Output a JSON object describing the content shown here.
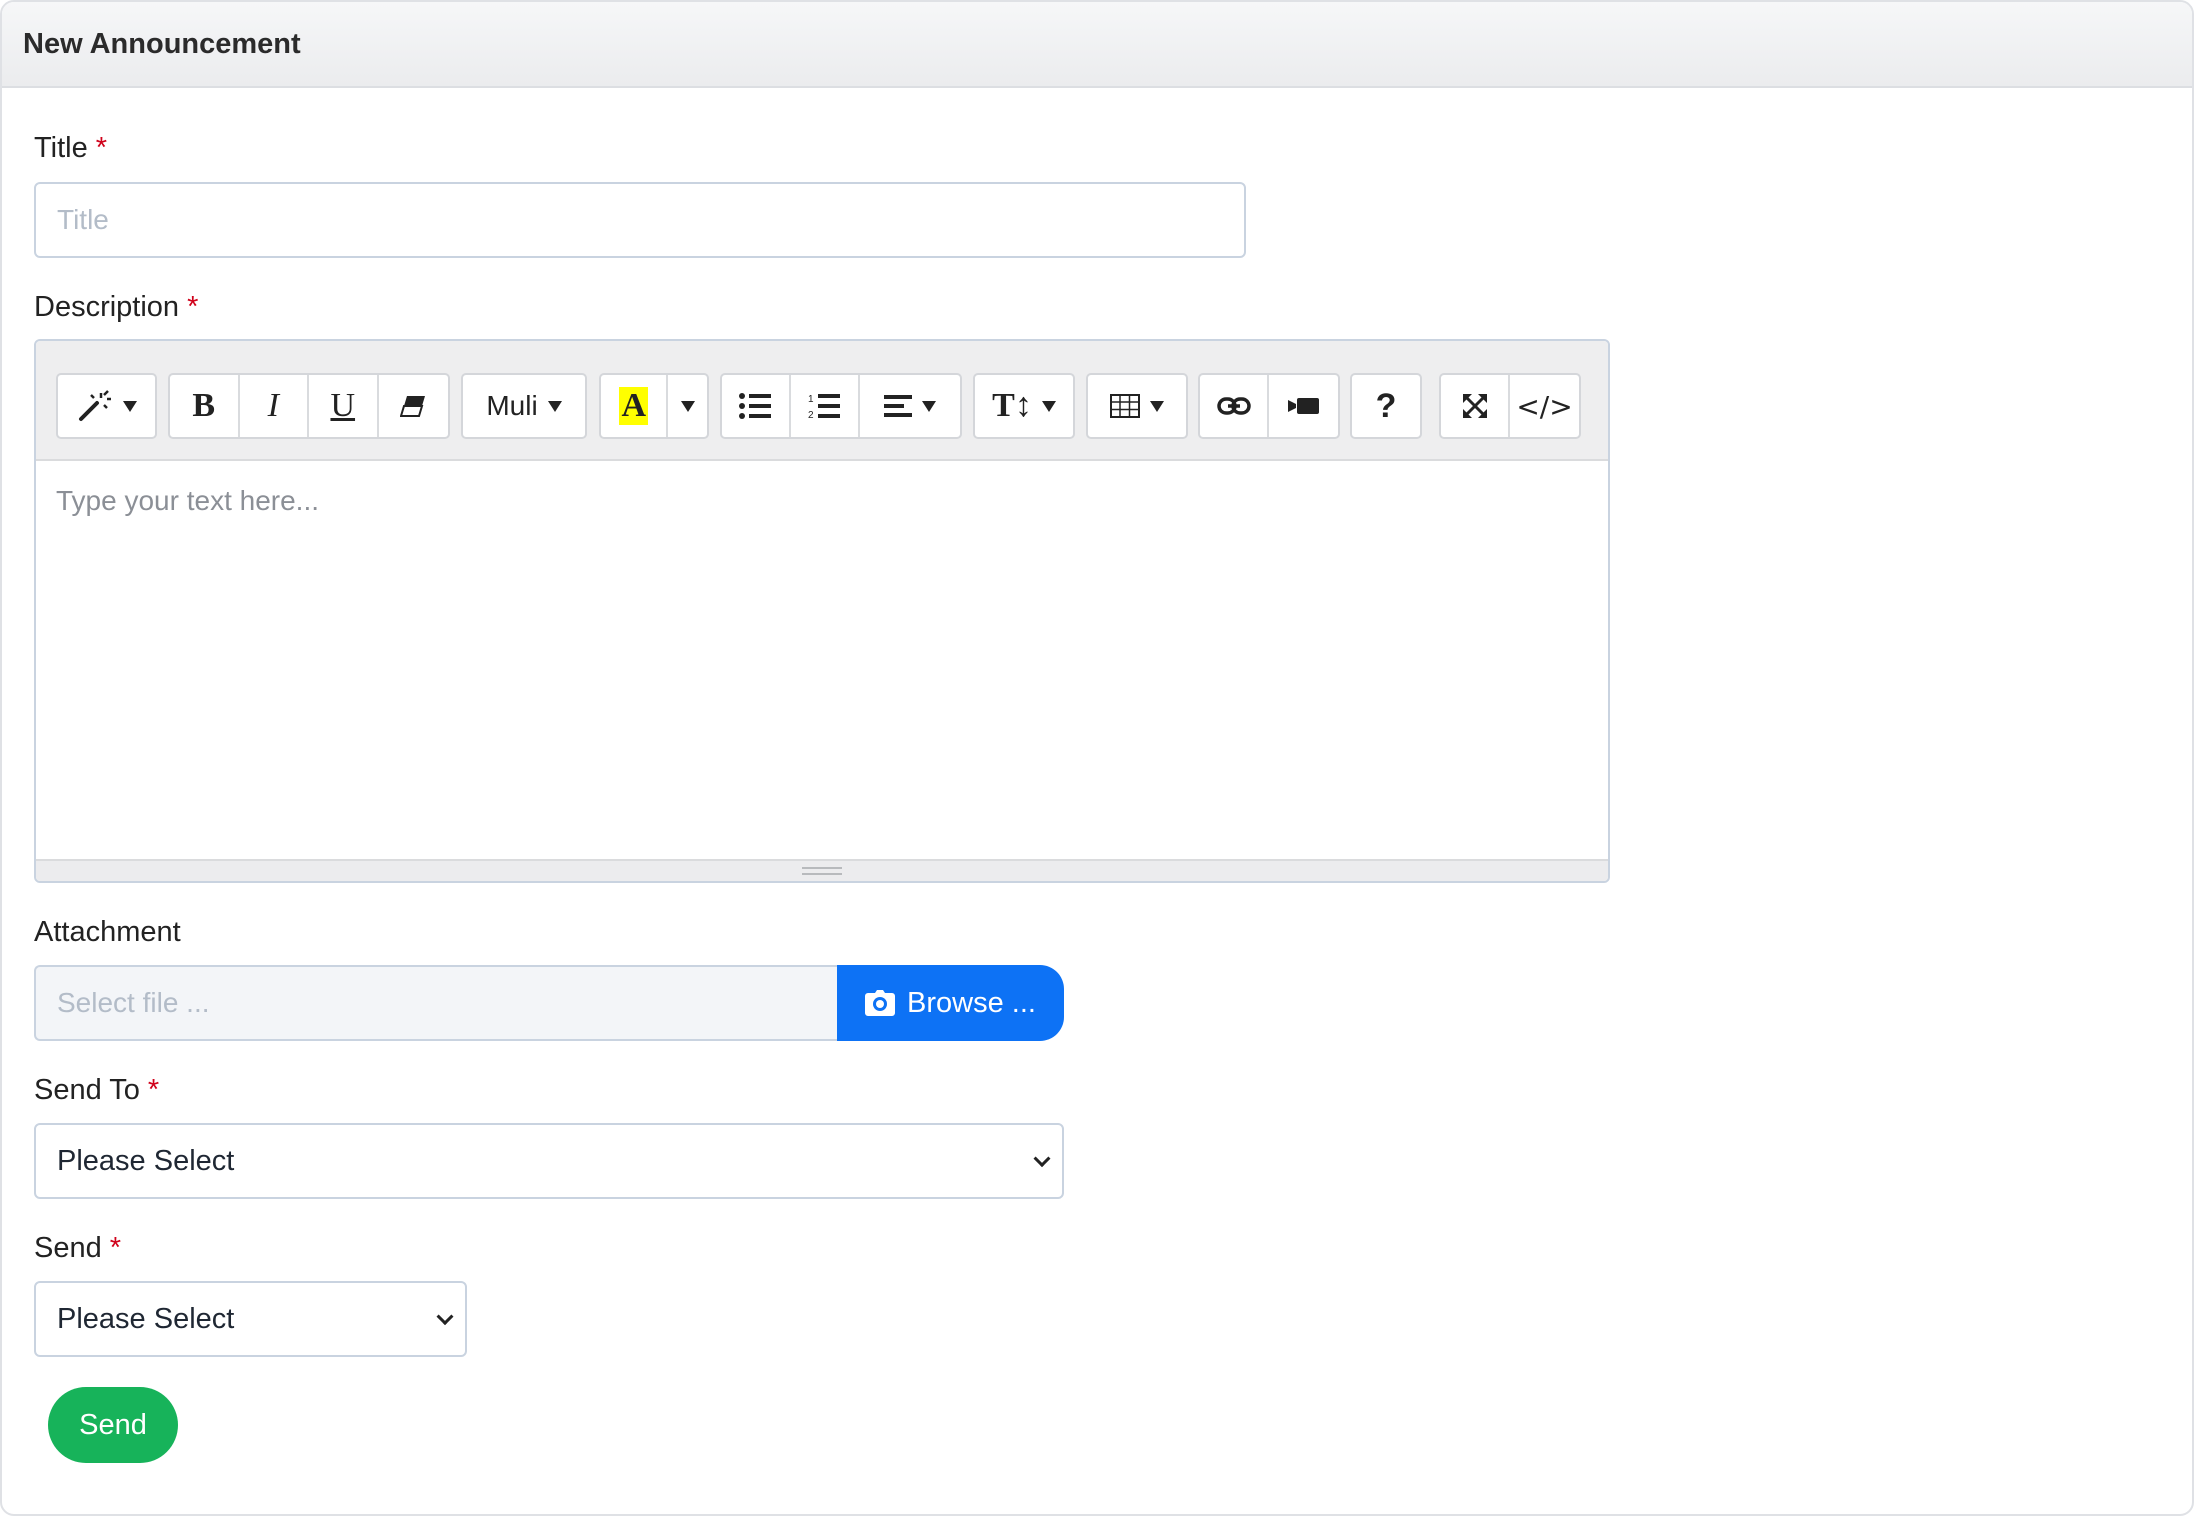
{
  "header": {
    "title": "New Announcement"
  },
  "form": {
    "required_mark": "*",
    "title": {
      "label": "Title",
      "placeholder": "Title"
    },
    "description": {
      "label": "Description",
      "placeholder": "Type your text here..."
    },
    "attachment": {
      "label": "Attachment",
      "placeholder": "Select file ...",
      "browse_label": "Browse ..."
    },
    "send_to": {
      "label": "Send To",
      "selected": "Please Select"
    },
    "send": {
      "label": "Send",
      "selected": "Please Select"
    },
    "submit_label": "Send"
  },
  "toolbar": {
    "font_name": "Muli",
    "highlight_color": "#ffff00",
    "code_view_label": "</>",
    "help_label": "?",
    "icons": [
      "magic-icon",
      "bold-icon",
      "italic-icon",
      "underline-icon",
      "eraser-icon",
      "font-name",
      "font-color-icon",
      "unordered-list-icon",
      "ordered-list-icon",
      "align-icon",
      "text-height-icon",
      "table-icon",
      "link-icon",
      "video-icon",
      "help-icon",
      "fullscreen-icon",
      "code-view-icon"
    ]
  },
  "colors": {
    "primary": "#0d72f5",
    "success": "#17b35a",
    "required": "#d0021b"
  }
}
